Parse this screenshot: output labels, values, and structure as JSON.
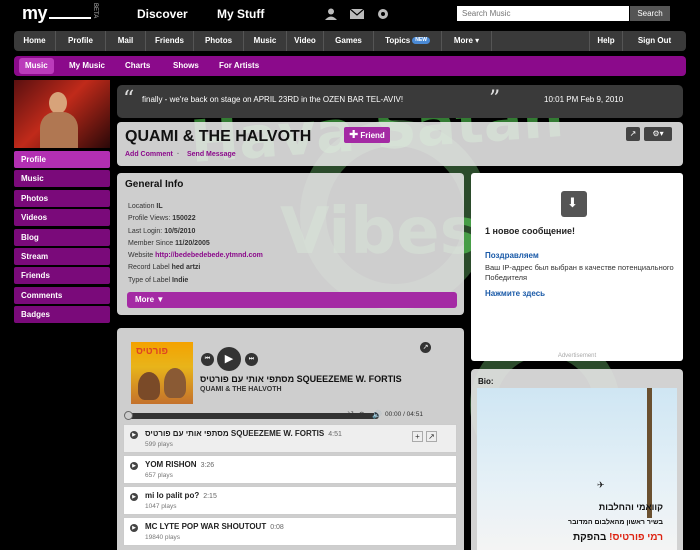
{
  "header": {
    "logo": "my",
    "beta": "BETA",
    "nav": [
      "Discover",
      "My Stuff"
    ],
    "icons": [
      "user-icon",
      "mail-icon",
      "gear-icon"
    ],
    "search": {
      "placeholder": "Search Music",
      "button": "Search"
    }
  },
  "mainnav": {
    "items": [
      "Home",
      "Profile",
      "Mail",
      "Friends",
      "Photos",
      "Music",
      "Video",
      "Games",
      "Topics",
      "More ▾",
      "Help",
      "Sign Out"
    ],
    "new_badge": "NEW"
  },
  "subnav": {
    "items": [
      "Music",
      "My Music",
      "Charts",
      "Shows",
      "For Artists"
    ],
    "active": "Music"
  },
  "sidebar": {
    "items": [
      "Profile",
      "Music",
      "Photos",
      "Videos",
      "Blog",
      "Stream",
      "Friends",
      "Comments",
      "Badges"
    ],
    "active": "Profile"
  },
  "status": {
    "message": "finally - we're back on stage on APRIL 23RD in the OZEN BAR TEL-AVIV!",
    "time": "10:01 PM Feb 9, 2010"
  },
  "profile": {
    "name": "QUAMI & THE HALVOTH",
    "friend_button": "Friend",
    "add_comment": "Add Comment",
    "send_message": "Send Message",
    "separator": "·"
  },
  "general_info": {
    "title": "General Info",
    "rows": [
      {
        "label": "Location",
        "value": "IL"
      },
      {
        "label": "Profile Views:",
        "value": "150022"
      },
      {
        "label": "Last Login:",
        "value": "10/5/2010"
      },
      {
        "label": "Member Since",
        "value": "11/20/2005"
      },
      {
        "label": "Website",
        "value": "http://bedebedebede.ytmnd.com"
      },
      {
        "label": "Record Label",
        "value": "hed artzi"
      },
      {
        "label": "Type of Label",
        "value": "Indie"
      }
    ],
    "more": "More ▼"
  },
  "ad": {
    "heading": "1 новое сообщение!",
    "link1": "Поздравляем",
    "text": "Ваш IP-адрес был выбран в качестве потенциального Победителя",
    "link2": "Нажмите здесь",
    "label": "Advertisement"
  },
  "player": {
    "cover_text": "פורטיס",
    "now_playing": "מסתפי אותי עם פורטיס SQUEEZEME W. FORTIS",
    "artist": "QUAMI  & THE HALVOTH",
    "time": "00:00 / 04:51",
    "progress": 0,
    "tracks": [
      {
        "title": "מסתפי אותי עם פורטיס SQUEEZEME W. FORTIS",
        "duration": "4:51",
        "plays": "599 plays"
      },
      {
        "title": "YOM RISHON",
        "duration": "3:26",
        "plays": "657 plays"
      },
      {
        "title": "mi lo palit po?",
        "duration": "2:15",
        "plays": "1047 plays"
      },
      {
        "title": "MC LYTE POP WAR SHOUTOUT",
        "duration": "0:08",
        "plays": "19840 plays"
      }
    ]
  },
  "bio": {
    "title": "Bio:",
    "line1": "קוואמי והחלבות",
    "line2": "בשיר ראשון מהאלבום המדובר",
    "line3_a": "בהפקת",
    "line3_b": "רמי פורטיס!"
  },
  "background_art": {
    "line1": "Hava Satan",
    "line2": "Vibes"
  },
  "colors": {
    "accent": "#8b0a8b",
    "accent_light": "#b22fb2",
    "link_blue": "#1a5aa8"
  }
}
